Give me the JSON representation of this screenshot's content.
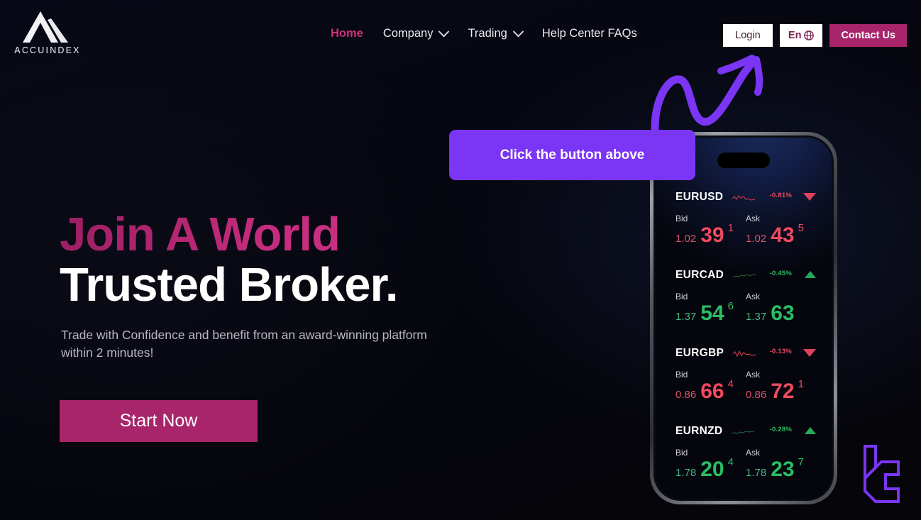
{
  "brand": {
    "name": "ACCUINDEX",
    "logo_icon": "mountain-logo-icon"
  },
  "nav": {
    "items": [
      {
        "label": "Home",
        "active": true,
        "has_dropdown": false
      },
      {
        "label": "Company",
        "active": false,
        "has_dropdown": true
      },
      {
        "label": "Trading",
        "active": false,
        "has_dropdown": true
      },
      {
        "label": "Help Center FAQs",
        "active": false,
        "has_dropdown": false
      }
    ]
  },
  "header_actions": {
    "login_label": "Login",
    "language_label": "En",
    "language_icon": "globe-icon",
    "contact_label": "Contact Us"
  },
  "hero": {
    "headline_line1": "Join A World",
    "headline_line2": "Trusted Broker.",
    "subtext": "Trade with Confidence and benefit from an award-winning platform within 2 minutes!",
    "cta_label": "Start Now"
  },
  "callout": {
    "text": "Click the button above",
    "color": "#7b35f5",
    "arrow_icon": "curved-up-arrow-icon"
  },
  "phone": {
    "notch_icon": "dynamic-island",
    "quotes": [
      {
        "symbol": "EURUSD",
        "change_pct": "-0.81%",
        "direction": "down",
        "trend_icon": "triangle-down-icon",
        "sparkline_icon": "sparkline-icon",
        "bid_label": "Bid",
        "bid_int": "1.02",
        "bid_big": "39",
        "bid_sup": "1",
        "ask_label": "Ask",
        "ask_int": "1.02",
        "ask_big": "43",
        "ask_sup": "5"
      },
      {
        "symbol": "EURCAD",
        "change_pct": "-0.45%",
        "direction": "up",
        "trend_icon": "triangle-up-icon",
        "sparkline_icon": "sparkline-icon",
        "bid_label": "Bid",
        "bid_int": "1.37",
        "bid_big": "54",
        "bid_sup": "6",
        "ask_label": "Ask",
        "ask_int": "1.37",
        "ask_big": "63",
        "ask_sup": ""
      },
      {
        "symbol": "EURGBP",
        "change_pct": "-0.13%",
        "direction": "down",
        "trend_icon": "triangle-down-icon",
        "sparkline_icon": "sparkline-icon",
        "bid_label": "Bid",
        "bid_int": "0.86",
        "bid_big": "66",
        "bid_sup": "4",
        "ask_label": "Ask",
        "ask_int": "0.86",
        "ask_big": "72",
        "ask_sup": "1"
      },
      {
        "symbol": "EURNZD",
        "change_pct": "-0.28%",
        "direction": "up",
        "trend_icon": "triangle-up-icon",
        "sparkline_icon": "sparkline-icon",
        "bid_label": "Bid",
        "bid_int": "1.78",
        "bid_big": "20",
        "bid_sup": "4",
        "ask_label": "Ask",
        "ask_int": "1.78",
        "ask_big": "23",
        "ask_sup": "7"
      }
    ]
  },
  "decoration": {
    "corner_logo_icon": "purple-geometric-logo-icon",
    "accent_color": "#a9256b",
    "purple_color": "#7b35f5",
    "up_color": "#2bbd63",
    "down_color": "#ef4a5e"
  }
}
